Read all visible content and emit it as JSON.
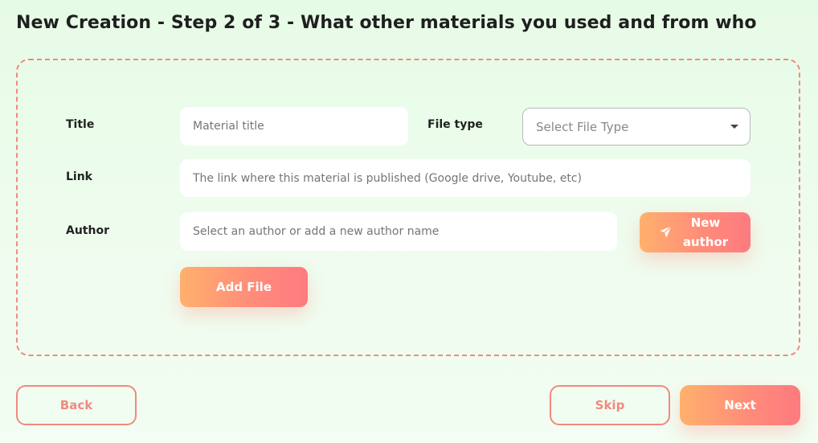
{
  "header": {
    "title": "New Creation - Step 2 of 3 - What other materials you used and from who"
  },
  "form": {
    "title_label": "Title",
    "title_placeholder": "Material title",
    "filetype_label": "File type",
    "filetype_placeholder": "Select File Type",
    "link_label": "Link",
    "link_placeholder": "The link where this material is published (Google drive, Youtube, etc)",
    "author_label": "Author",
    "author_placeholder": "Select an author or add a new author name",
    "new_author_line1": "New",
    "new_author_line2": "author",
    "add_file_label": "Add File",
    "icons": {
      "new_author": "send-icon",
      "select": "caret-down-icon"
    }
  },
  "footer": {
    "back_label": "Back",
    "skip_label": "Skip",
    "next_label": "Next"
  },
  "colors": {
    "accent": "#f08a7e",
    "gradient_start": "#ffb06d",
    "gradient_end": "#fd7b80",
    "background": "#e9fbe9"
  }
}
